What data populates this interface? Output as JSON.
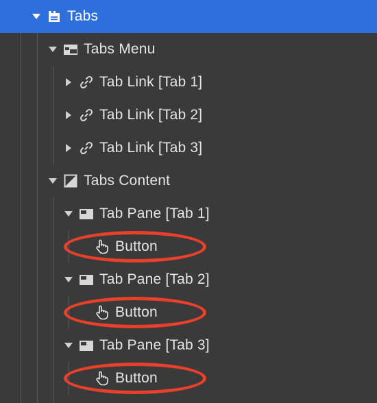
{
  "navigator": {
    "root": {
      "label": "Tabs",
      "icon": "tabs-icon",
      "expanded": true,
      "selected": true
    },
    "menu": {
      "label": "Tabs Menu",
      "icon": "tabs-menu-icon",
      "expanded": true,
      "links": [
        {
          "label": "Tab Link [Tab 1]",
          "icon": "link-icon",
          "expanded": false
        },
        {
          "label": "Tab Link [Tab 2]",
          "icon": "link-icon",
          "expanded": false
        },
        {
          "label": "Tab Link [Tab 3]",
          "icon": "link-icon",
          "expanded": false
        }
      ]
    },
    "content": {
      "label": "Tabs Content",
      "icon": "tabs-content-icon",
      "expanded": true,
      "panes": [
        {
          "label": "Tab Pane [Tab 1]",
          "icon": "tab-pane-icon",
          "expanded": true,
          "child": {
            "label": "Button",
            "icon": "hand-pointer-icon"
          }
        },
        {
          "label": "Tab Pane [Tab 2]",
          "icon": "tab-pane-icon",
          "expanded": true,
          "child": {
            "label": "Button",
            "icon": "hand-pointer-icon"
          }
        },
        {
          "label": "Tab Pane [Tab 3]",
          "icon": "tab-pane-icon",
          "expanded": true,
          "child": {
            "label": "Button",
            "icon": "hand-pointer-icon"
          }
        }
      ]
    }
  },
  "colors": {
    "background": "#3a3a3a",
    "selected_row": "#2f6fdc",
    "text": "#e6e6e6",
    "annotation_circle": "#e8402a"
  }
}
